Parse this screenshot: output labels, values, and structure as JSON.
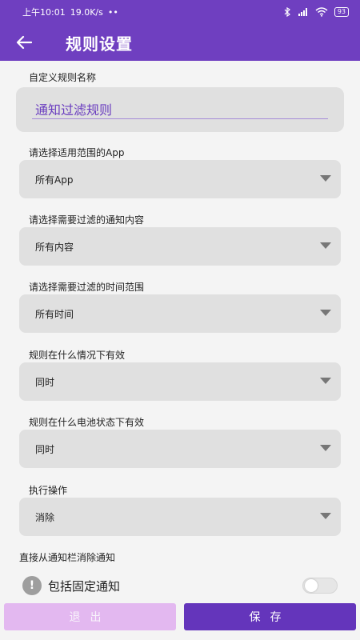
{
  "status_bar": {
    "time": "上午10:01",
    "net_speed": "19.0K/s",
    "battery": "93"
  },
  "app_bar": {
    "title": "规则设置"
  },
  "form": {
    "name_label": "自定义规则名称",
    "name_value": "通知过滤规则",
    "fields": [
      {
        "label": "请选择适用范围的App",
        "value": "所有App"
      },
      {
        "label": "请选择需要过滤的通知内容",
        "value": "所有内容"
      },
      {
        "label": "请选择需要过滤的时间范围",
        "value": "所有时间"
      },
      {
        "label": "规则在什么情况下有效",
        "value": "同时"
      },
      {
        "label": "规则在什么电池状态下有效",
        "value": "同时"
      },
      {
        "label": "执行操作",
        "value": "消除"
      }
    ],
    "dismiss_section": "直接从通知栏消除通知",
    "include_fixed": {
      "label": "包括固定通知",
      "icon": "!",
      "checked": false
    }
  },
  "buttons": {
    "exit": "退出",
    "save": "保存"
  },
  "colors": {
    "primary": "#6f3fc0",
    "save": "#6435bb",
    "exit": "#e3b8f0"
  }
}
